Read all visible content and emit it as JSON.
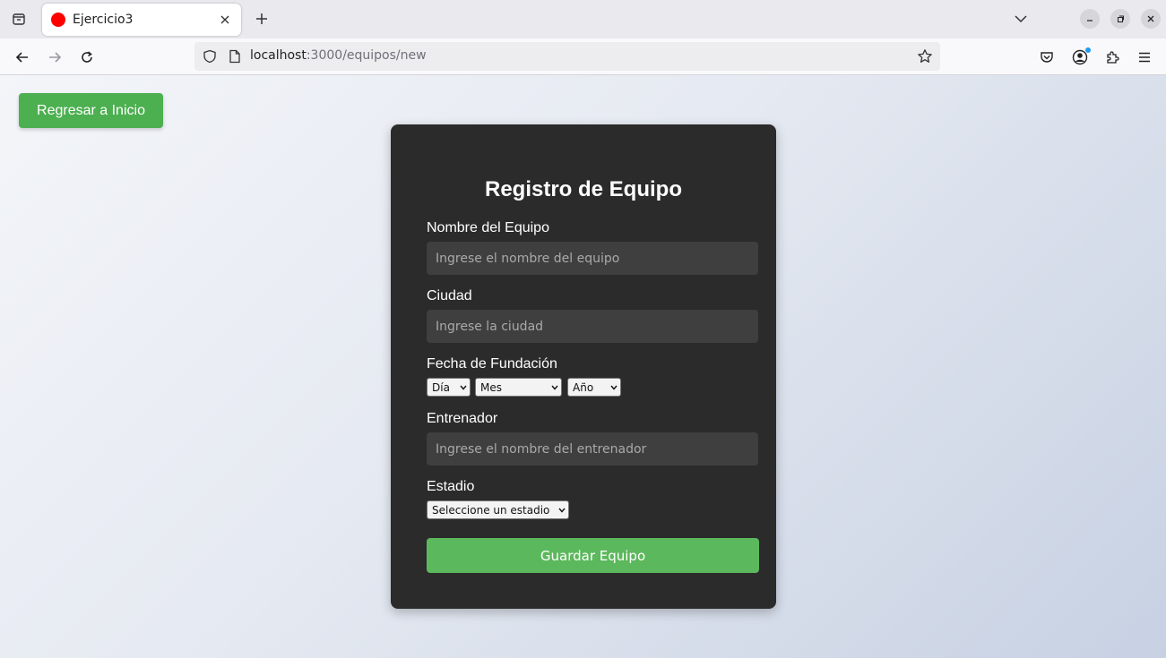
{
  "browser": {
    "tab": {
      "title": "Ejercicio3",
      "favicon_color": "#ff0000"
    },
    "url": {
      "host": "localhost",
      "path": ":3000/equipos/new"
    },
    "icons": {
      "tab_list": "tab-list-icon",
      "close_tab": "close-icon",
      "new_tab": "plus-icon",
      "all_tabs": "chevron-down-icon",
      "minimize": "minimize-icon",
      "restore": "restore-icon",
      "close_window": "close-icon",
      "back": "arrow-left-icon",
      "forward": "arrow-right-icon",
      "reload": "reload-icon",
      "shield": "shield-icon",
      "page": "page-icon",
      "bookmark": "star-icon",
      "pocket": "pocket-icon",
      "account": "account-icon",
      "extensions": "puzzle-icon",
      "menu": "hamburger-icon"
    }
  },
  "page": {
    "back_button_label": "Regresar a Inicio",
    "form": {
      "title": "Registro de Equipo",
      "nombre": {
        "label": "Nombre del Equipo",
        "placeholder": "Ingrese el nombre del equipo",
        "value": ""
      },
      "ciudad": {
        "label": "Ciudad",
        "placeholder": "Ingrese la ciudad",
        "value": ""
      },
      "fecha": {
        "label": "Fecha de Fundación",
        "dia": "Día",
        "mes": "Mes",
        "anio": "Año"
      },
      "entrenador": {
        "label": "Entrenador",
        "placeholder": "Ingrese el nombre del entrenador",
        "value": ""
      },
      "estadio": {
        "label": "Estadio",
        "selected": "Seleccione un estadio"
      },
      "submit_label": "Guardar Equipo"
    }
  },
  "colors": {
    "accent_green": "#4caf50",
    "submit_green": "#5cb85c",
    "card_bg": "#2b2b2b",
    "input_bg": "#3f3f3f"
  }
}
